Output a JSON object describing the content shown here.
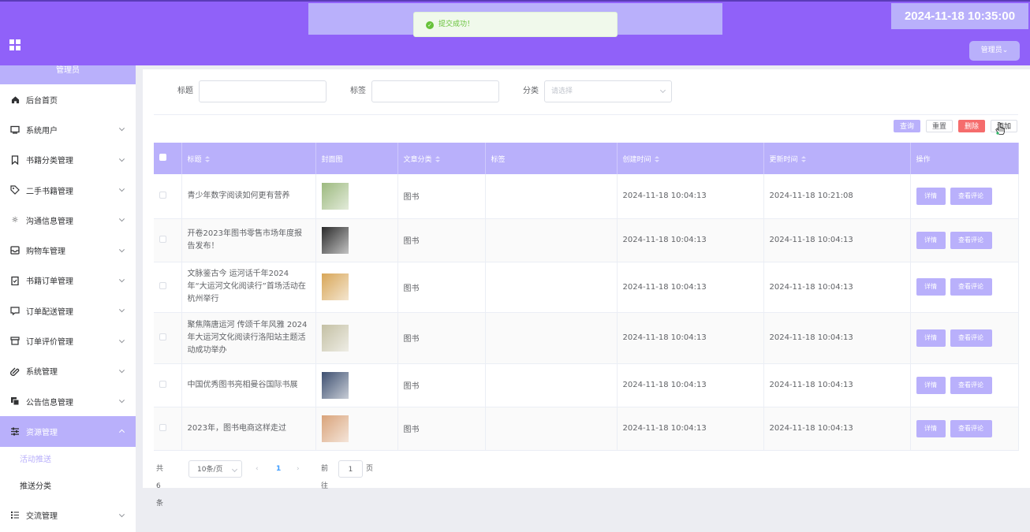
{
  "header": {
    "datetime": "2024-11-18 10:35:00",
    "admin_label": "管理员⌄",
    "toast": "提交成功！"
  },
  "sidebar": {
    "top_label": "管理员",
    "items": [
      {
        "label": "后台首页",
        "icon": "home-icon"
      },
      {
        "label": "系统用户",
        "icon": "monitor-icon"
      },
      {
        "label": "书籍分类管理",
        "icon": "bookmark-icon"
      },
      {
        "label": "二手书籍管理",
        "icon": "tag-icon"
      },
      {
        "label": "沟通信息管理",
        "icon": "sun-icon"
      },
      {
        "label": "购物车管理",
        "icon": "inbox-icon"
      },
      {
        "label": "书籍订单管理",
        "icon": "clipboard-icon"
      },
      {
        "label": "订单配送管理",
        "icon": "message-icon"
      },
      {
        "label": "订单评价管理",
        "icon": "archive-icon"
      },
      {
        "label": "系统管理",
        "icon": "paperclip-icon"
      },
      {
        "label": "公告信息管理",
        "icon": "copy-icon"
      },
      {
        "label": "资源管理",
        "icon": "sliders-icon"
      },
      {
        "label": "交流管理",
        "icon": "list-icon"
      }
    ],
    "sub_items": [
      "活动推送",
      "推送分类"
    ]
  },
  "filter": {
    "title_label": "标题",
    "tag_label": "标签",
    "category_label": "分类",
    "category_placeholder": "请选择"
  },
  "toolbar": {
    "query": "查询",
    "reset": "重置",
    "delete": "删除",
    "add": "添加"
  },
  "table": {
    "headers": [
      "标题",
      "封面图",
      "文章分类",
      "标签",
      "创建时间",
      "更新时间",
      "操作"
    ],
    "detail_btn": "详情",
    "comment_btn": "查看评论",
    "rows": [
      {
        "title": "青少年数字阅读如何更有营养",
        "category": "图书",
        "tag": "",
        "created": "2024-11-18 10:04:13",
        "updated": "2024-11-18 10:21:08",
        "thumb_color": "#9cb97e"
      },
      {
        "title": "开卷2023年图书零售市场年度报告发布！",
        "category": "图书",
        "tag": "",
        "created": "2024-11-18 10:04:13",
        "updated": "2024-11-18 10:04:13",
        "thumb_color": "#2b2b2b"
      },
      {
        "title": "文脉鉴古今 运河话千年2024年“大运河文化阅读行”首场活动在杭州举行",
        "category": "图书",
        "tag": "",
        "created": "2024-11-18 10:04:13",
        "updated": "2024-11-18 10:04:13",
        "thumb_color": "#d8a658"
      },
      {
        "title": "聚焦隋唐运河 传颂千年风雅 2024年大运河文化阅读行洛阳站主题活动成功举办",
        "category": "图书",
        "tag": "",
        "created": "2024-11-18 10:04:13",
        "updated": "2024-11-18 10:04:13",
        "thumb_color": "#c4c0a4"
      },
      {
        "title": "中国优秀图书亮相曼谷国际书展",
        "category": "图书",
        "tag": "",
        "created": "2024-11-18 10:04:13",
        "updated": "2024-11-18 10:04:13",
        "thumb_color": "#3d4f70"
      },
      {
        "title": "2023年，图书电商这样走过",
        "category": "图书",
        "tag": "",
        "created": "2024-11-18 10:04:13",
        "updated": "2024-11-18 10:04:13",
        "thumb_color": "#d9a37a"
      }
    ]
  },
  "pagination": {
    "total": "共 6 条",
    "page_size": "10条/页",
    "current": "1",
    "goto_label": "前往",
    "goto_value": "1",
    "page_suffix": "页"
  },
  "colors": {
    "header": "#9061f9",
    "accent": "#b9b0fb",
    "danger": "#f56c6c",
    "success": "#67c23a"
  }
}
